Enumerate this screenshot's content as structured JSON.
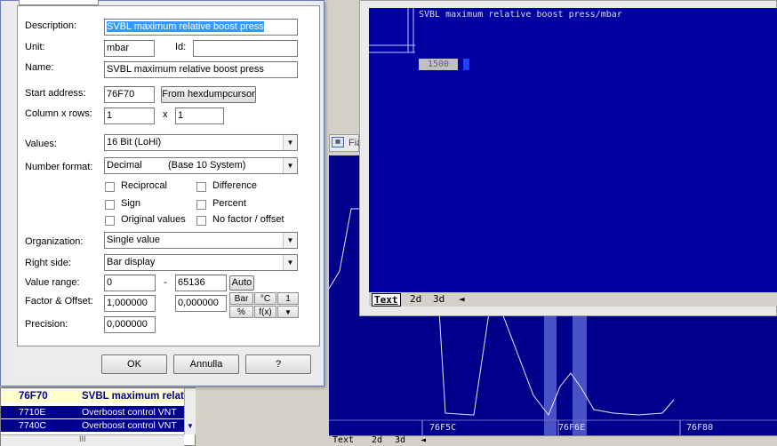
{
  "dialog": {
    "description_label": "Description:",
    "description_value": "SVBL maximum relative boost press",
    "unit_label": "Unit:",
    "unit_value": "mbar",
    "id_label": "Id:",
    "id_value": "",
    "name_label": "Name:",
    "name_value": "SVBL maximum relative boost press",
    "start_address_label": "Start address:",
    "start_address_value": "76F70",
    "from_hexdump_label": "From hexdumpcursor",
    "colrows_label": "Column x rows:",
    "columns_value": "1",
    "x_label": "x",
    "rows_value": "1",
    "values_label": "Values:",
    "values_value": "16 Bit (LoHi)",
    "number_format_label": "Number format:",
    "number_format_value": "Decimal",
    "number_format_note": "(Base 10 System)",
    "checkboxes": {
      "reciprocal": "Reciprocal",
      "difference": "Difference",
      "sign": "Sign",
      "percent": "Percent",
      "original_values": "Original values",
      "no_factor_offset": "No factor / offset"
    },
    "organization_label": "Organization:",
    "organization_value": "Single value",
    "right_side_label": "Right side:",
    "right_side_value": "Bar display",
    "value_range_label": "Value range:",
    "range_min": "0",
    "range_dash": "-",
    "range_max": "65136",
    "auto_label": "Auto",
    "factor_offset_label": "Factor & Offset:",
    "factor_value": "1,000000",
    "offset_value": "0,000000",
    "bar_label": "Bar",
    "celsius_label": "°C",
    "one_label": "1",
    "percent_label": "%",
    "fx_label": "f(x)",
    "down_label": "▼",
    "precision_label": "Precision:",
    "precision_value": "0,000000",
    "ok_label": "OK",
    "cancel_label": "Annulla",
    "help_label": "?"
  },
  "graph_window": {
    "map_title": "SVBL maximum relative boost press/mbar",
    "cell_value": "1500",
    "tabs": [
      "Text",
      "2d",
      "3d"
    ],
    "nav_arrow": "◄"
  },
  "hex_view": {
    "axis_labels": [
      "76F5C",
      "76F6E",
      "76F80"
    ],
    "tabs": [
      "Text",
      "2d",
      "3d"
    ],
    "nav_arrow": "◄"
  },
  "stub_window": {
    "title_fragment": "Fia"
  },
  "map_list": {
    "rows": [
      {
        "address": "76F70",
        "name": "SVBL maximum relat",
        "selected": true
      },
      {
        "address": "7710E",
        "name": "Overboost control VNT",
        "selected": false
      },
      {
        "address": "7740C",
        "name": "Overboost control VNT",
        "selected": false
      }
    ],
    "scroll_grip": "III"
  },
  "colors": {
    "hex_bg": "#00008b",
    "graph_bg": "#0000a0",
    "selection": "#3399ff",
    "list_bg": "#00008b",
    "list_selected_bg": "#ffffcc"
  }
}
